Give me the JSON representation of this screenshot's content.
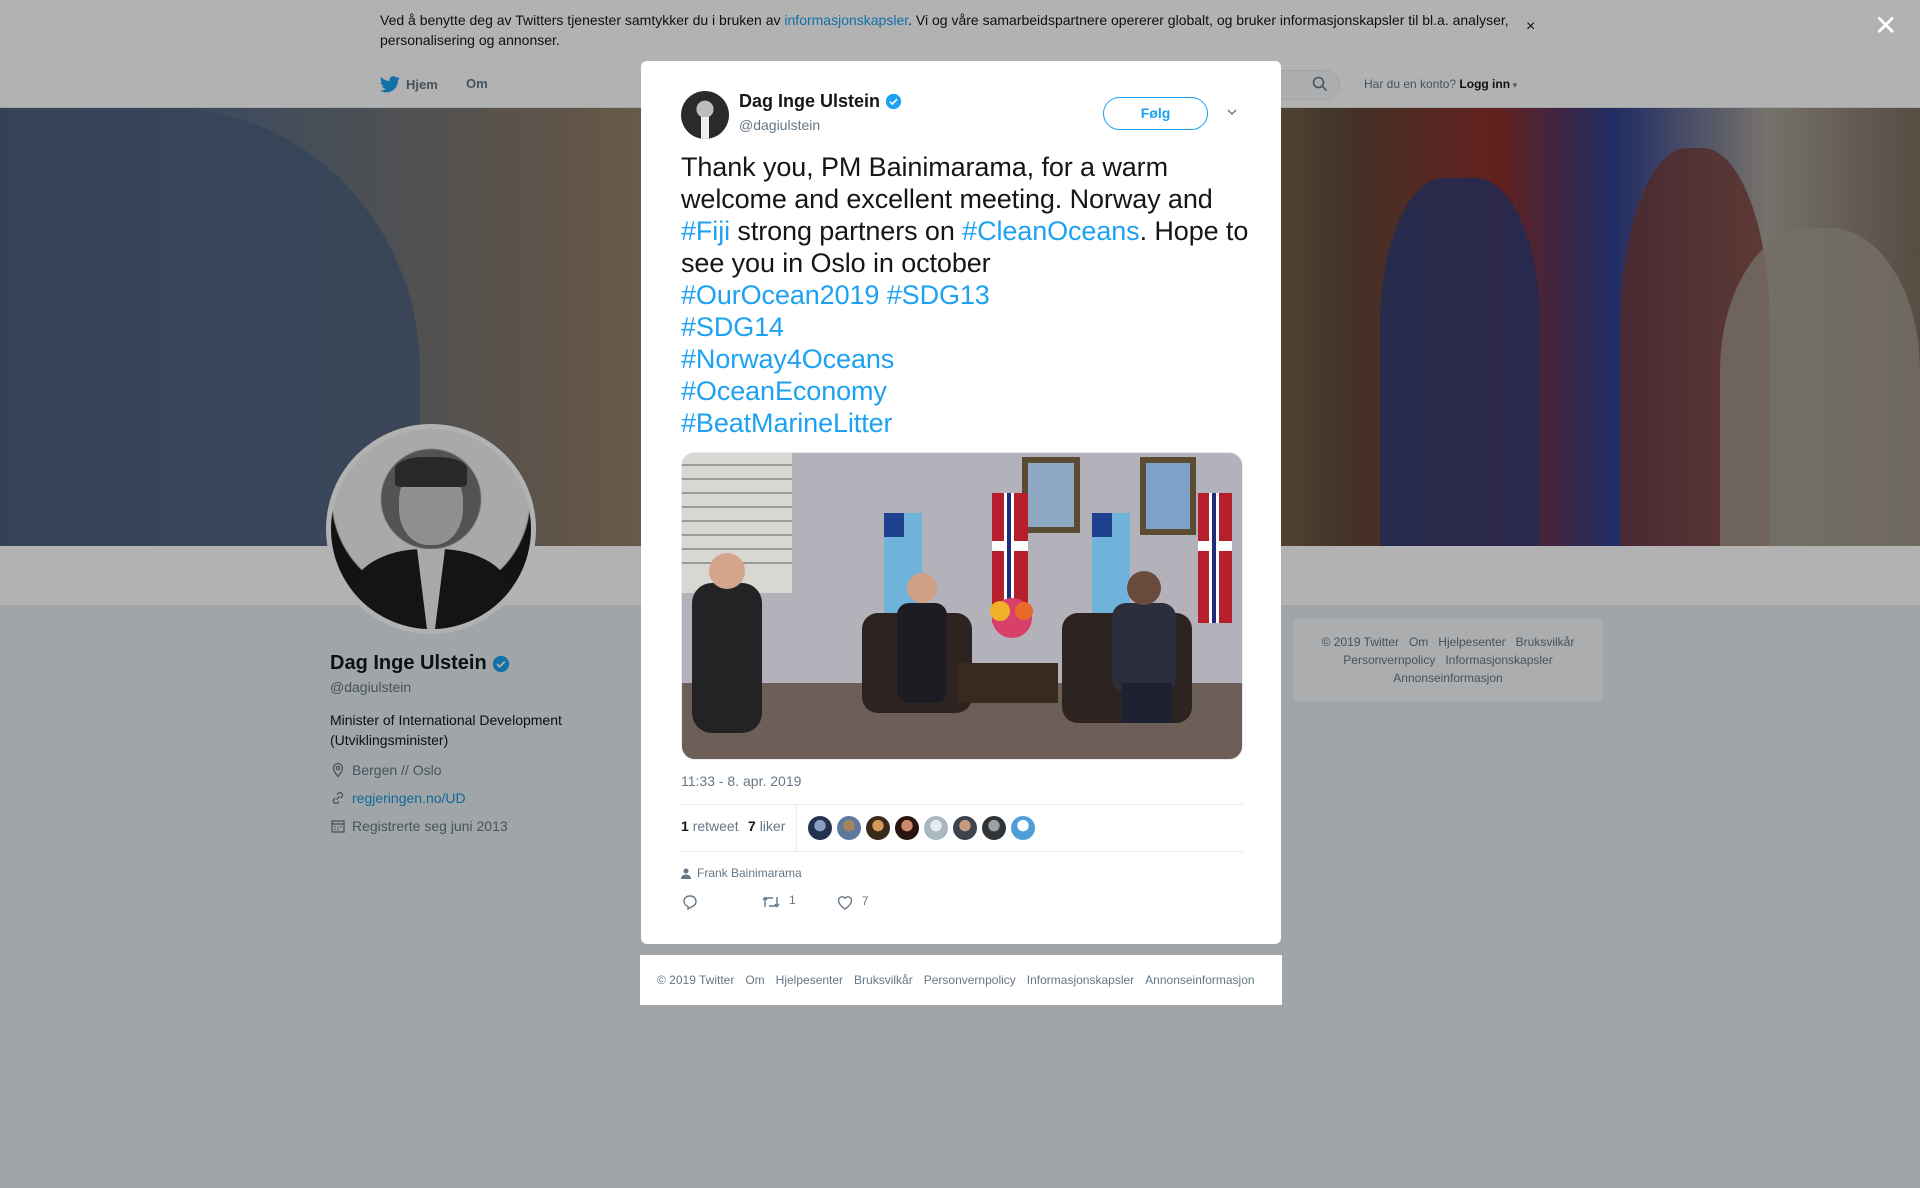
{
  "cookie_banner": {
    "text_before": "Ved å benytte deg av Twitters tjenester samtykker du i bruken av ",
    "link": "informasjonskapsler",
    "text_after": ". Vi og våre samarbeidspartnere opererer globalt, og bruker informasjonskapsler til bl.a. analyser, personalisering og annonser.",
    "close": "×"
  },
  "nav": {
    "home": "Hjem",
    "about": "Om",
    "login_prompt": "Har du en konto?",
    "login": "Logg inn"
  },
  "profile": {
    "name": "Dag Inge Ulstein",
    "handle": "@dagiulstein",
    "bio": "Minister of International Development (Utviklingsminister)",
    "location": "Bergen // Oslo",
    "website": "regjeringen.no/UD",
    "joined": "Registrerte seg juni 2013"
  },
  "sidebar_footer": {
    "row1": [
      "© 2019 Twitter",
      "Om",
      "Hjelpesenter",
      "Bruksvilkår"
    ],
    "row2": [
      "Personvernpolicy",
      "Informasjonskapsler"
    ],
    "row3": [
      "Annonseinformasjon"
    ]
  },
  "overlay": {
    "close": "✕"
  },
  "tweet": {
    "author_name": "Dag Inge Ulstein",
    "author_handle": "@dagiulstein",
    "follow_label": "Følg",
    "text": {
      "p1": "Thank you, PM Bainimarama, for a warm welcome and excellent meeting. Norway and ",
      "h1": "#Fiji",
      "p2": " strong partners on ",
      "h2": "#CleanOceans",
      "p3": ". Hope to see you in Oslo in october",
      "h3": "#OurOcean2019",
      "h4": "#SDG13",
      "h5": "#SDG14",
      "h6": "#Norway4Oceans",
      "h7": "#OceanEconomy",
      "h8": "#BeatMarineLitter"
    },
    "timestamp": "11:33 - 8. apr. 2019",
    "retweets_count": "1",
    "retweets_label": "retweet",
    "likes_count": "7",
    "likes_label": "liker",
    "tagged_person": "Frank Bainimarama",
    "actions": {
      "retweet_count": "1",
      "like_count": "7"
    }
  },
  "modal_footer": [
    "© 2019 Twitter",
    "Om",
    "Hjelpesenter",
    "Bruksvilkår",
    "Personvernpolicy",
    "Informasjonskapsler",
    "Annonseinformasjon"
  ],
  "colors": {
    "accent": "#1da1f2",
    "text": "#14171a",
    "muted": "#657786"
  }
}
